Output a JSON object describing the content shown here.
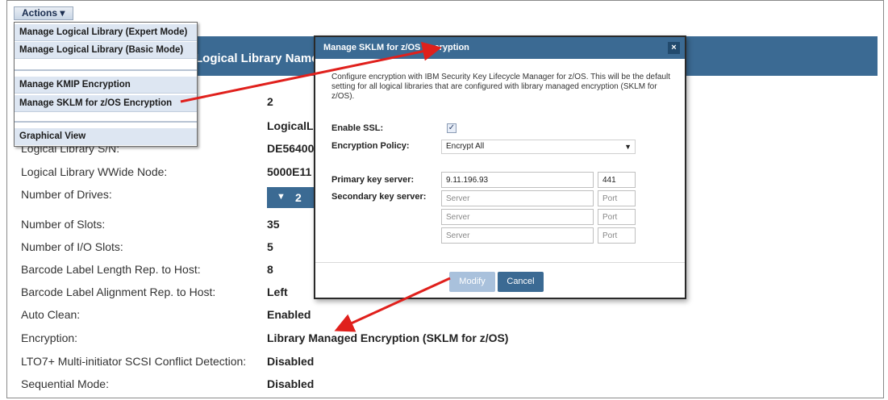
{
  "actions_menu": {
    "button_label": "Actions ▾",
    "items": [
      "Manage Logical Library (Expert Mode)",
      "Manage Logical Library (Basic Mode)",
      "Manage KMIP Encryption",
      "Manage SKLM for z/OS Encryption",
      "Graphical View"
    ]
  },
  "header": {
    "title": "Logical Library Name"
  },
  "properties": [
    {
      "label": "",
      "value": "2"
    },
    {
      "label": "",
      "value": "LogicalL"
    },
    {
      "label": "Logical Library S/N:",
      "value": "DE56400"
    },
    {
      "label": "Logical Library WWide Node:",
      "value": "5000E11"
    },
    {
      "label": "Number of Drives:",
      "value": "2"
    },
    {
      "label": "Number of Slots:",
      "value": "35"
    },
    {
      "label": "Number of I/O Slots:",
      "value": "5"
    },
    {
      "label": "Barcode Label Length Rep. to Host:",
      "value": "8"
    },
    {
      "label": "Barcode Label Alignment Rep. to Host:",
      "value": "Left"
    },
    {
      "label": "Auto Clean:",
      "value": "Enabled"
    },
    {
      "label": "Encryption:",
      "value": "Library Managed Encryption (SKLM for z/OS)"
    },
    {
      "label": "LTO7+ Multi-initiator SCSI Conflict Detection:",
      "value": "Disabled"
    },
    {
      "label": "Sequential Mode:",
      "value": "Disabled"
    }
  ],
  "dialog": {
    "title": "Manage SKLM for z/OS Encryption",
    "close_label": "×",
    "description": "Configure encryption with IBM Security Key Lifecycle Manager for z/OS. This will be the default setting for all logical libraries that are configured with library managed encryption (SKLM for z/OS).",
    "enable_ssl_label": "Enable SSL:",
    "enable_ssl_checked": true,
    "encryption_policy_label": "Encryption Policy:",
    "encryption_policy_value": "Encrypt All",
    "primary_key_server_label": "Primary key server:",
    "primary_server_value": "9.11.196.93",
    "primary_port_value": "441",
    "secondary_key_server_label": "Secondary key server:",
    "server_placeholder": "Server",
    "port_placeholder": "Port",
    "modify_label": "Modify",
    "cancel_label": "Cancel"
  },
  "colors": {
    "header_blue": "#3b6a93",
    "menu_item_bg": "#dde6f2",
    "annotation_arrow": "#e0201c"
  }
}
